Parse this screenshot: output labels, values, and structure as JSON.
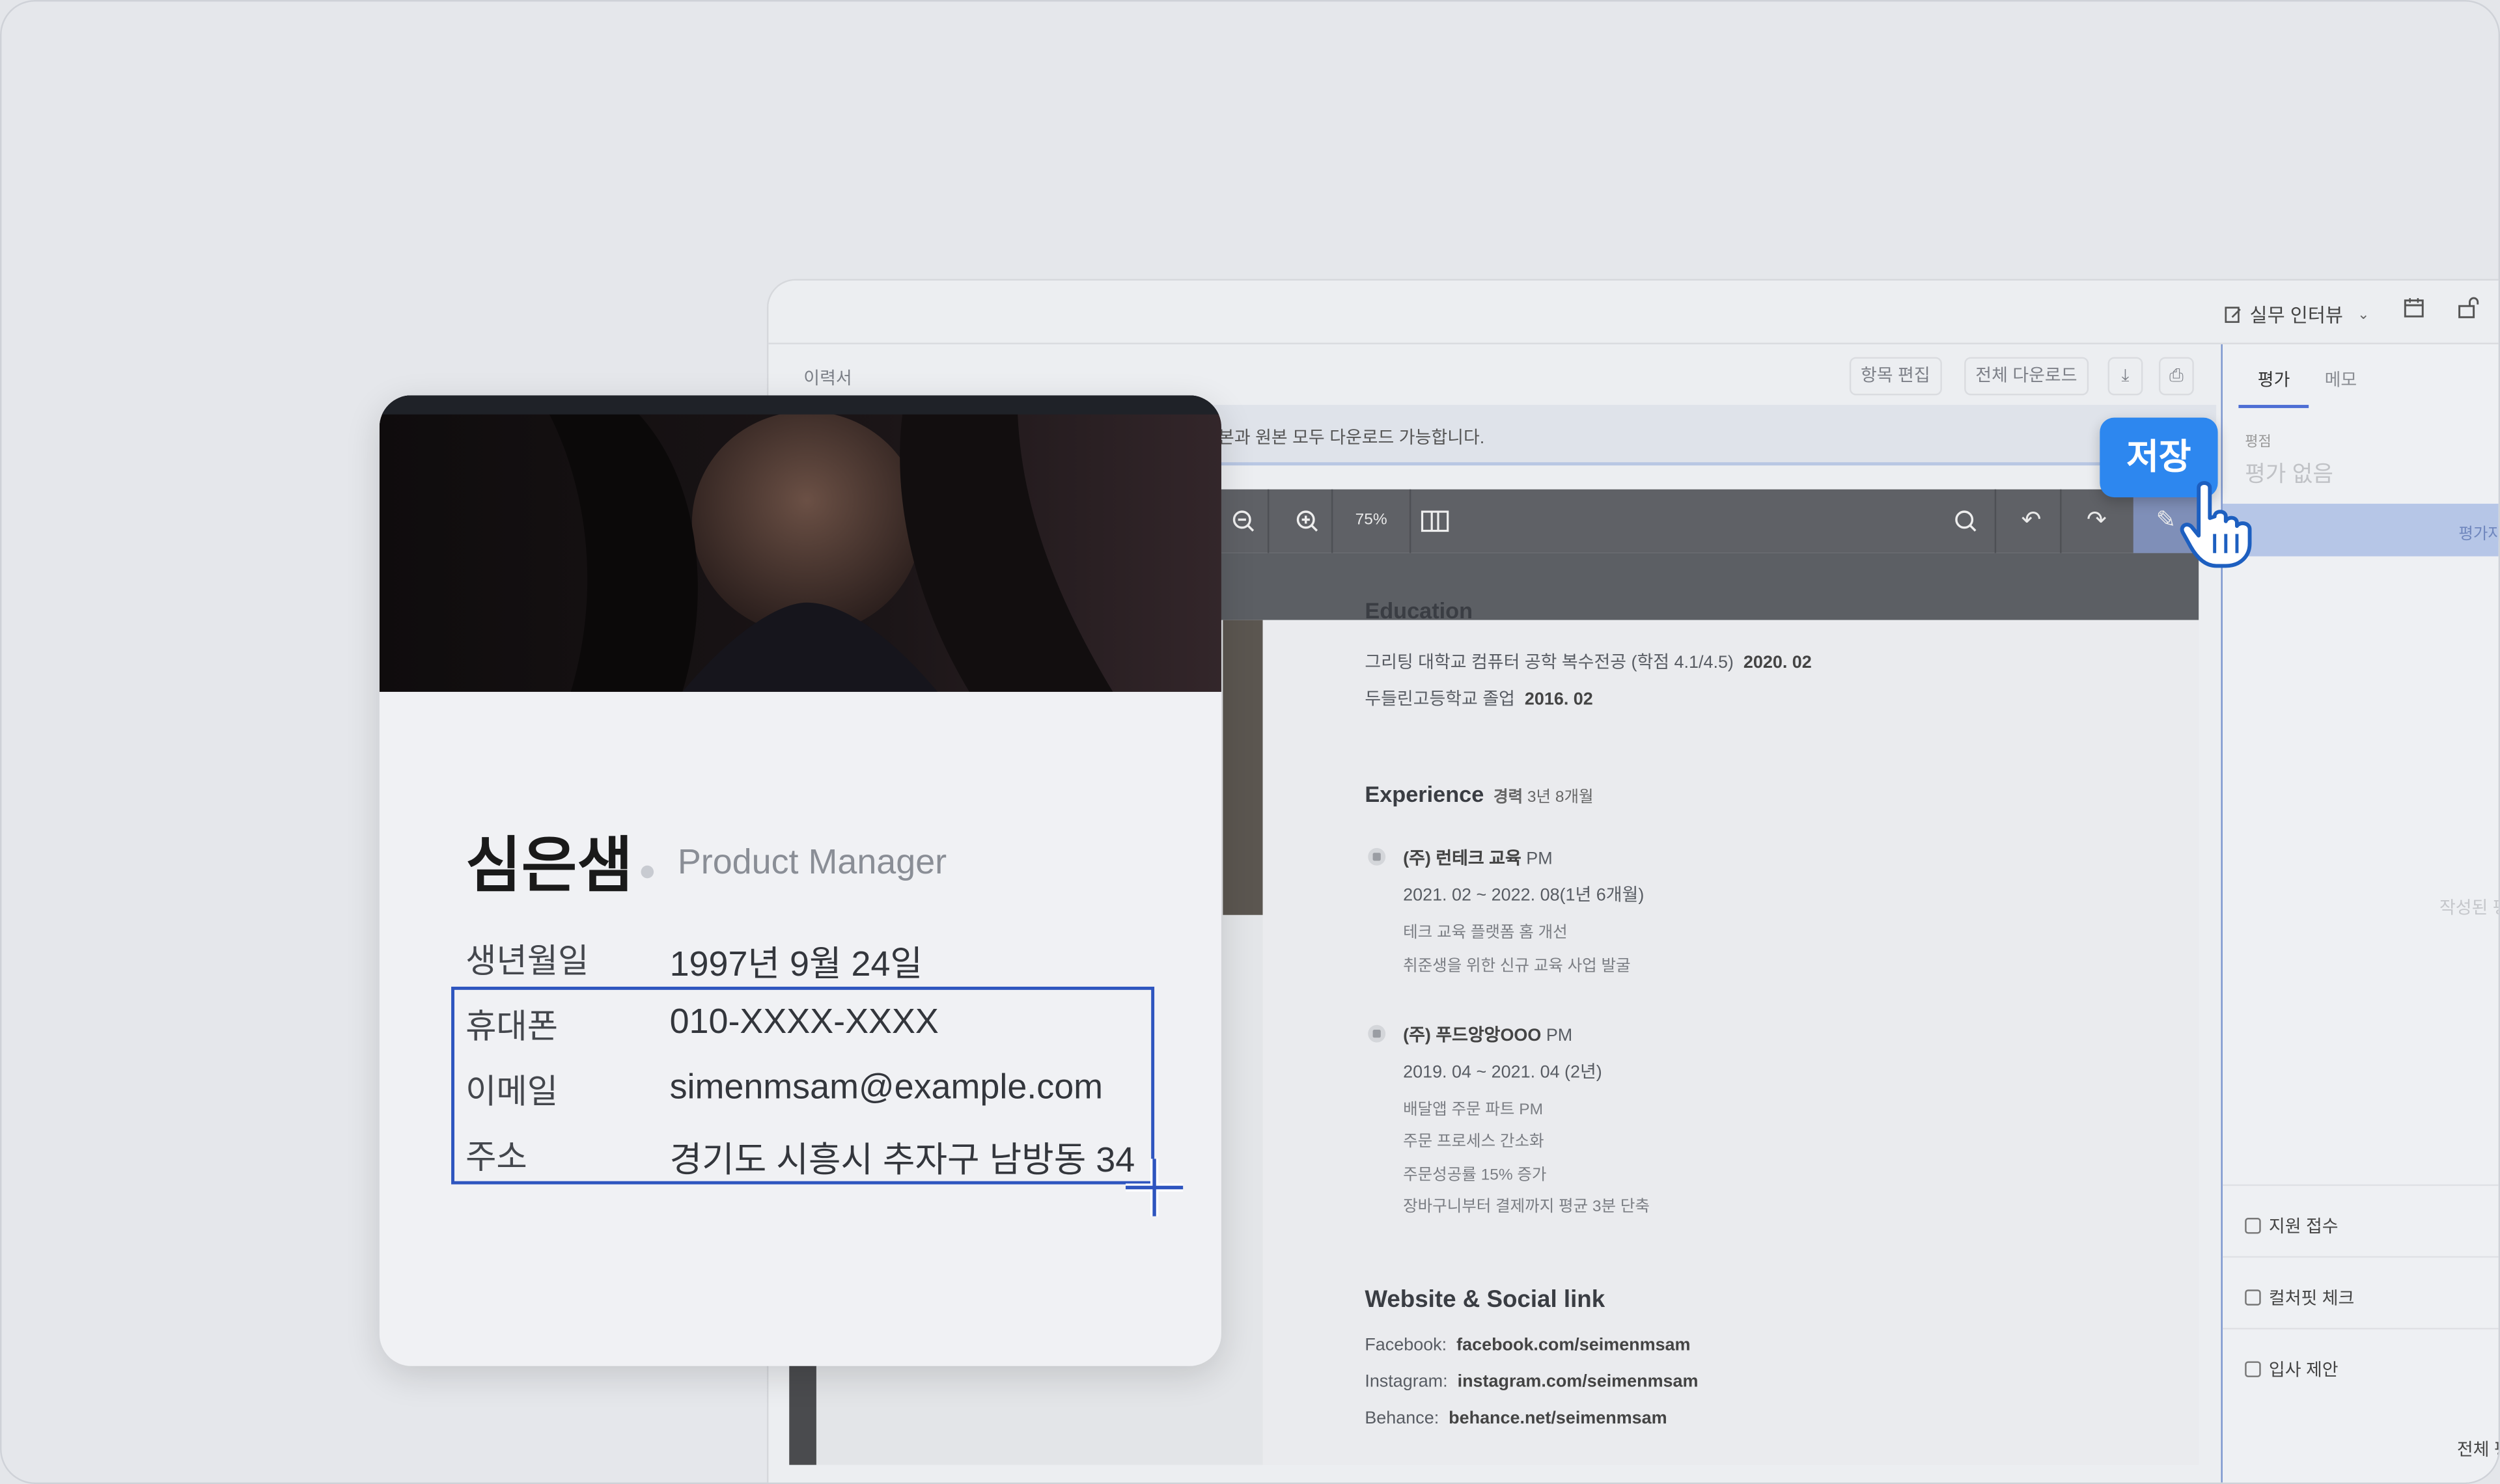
{
  "app": {
    "stage_dropdown": "실무 인터뷰",
    "section_title": "이력서",
    "toolbar": {
      "edit": "항목 편집",
      "download_all": "전체 다운로드"
    },
    "notice": "본과 원본 모두 다운로드 가능합니다.",
    "zoom": "75%"
  },
  "document": {
    "education_heading": "Education",
    "education": [
      {
        "text": "그리팅 대학교 컴퓨터 공학 복수전공 (학점 4.1/4.5)",
        "date": "2020. 02"
      },
      {
        "text": "두들린고등학교 졸업",
        "date": "2016. 02"
      }
    ],
    "experience_heading": "Experience",
    "experience_label": "경력",
    "experience_total": "3년 8개월",
    "experience": [
      {
        "company": "(주) 런테크 교육",
        "role": "PM",
        "period": "2021. 02 ~ 2022. 08(1년 6개월)",
        "lines": [
          "테크 교육 플랫폼 홈 개선",
          "취준생을 위한 신규 교육 사업 발굴"
        ]
      },
      {
        "company": "(주) 푸드앙앙OOO",
        "role": "PM",
        "period": "2019. 04 ~ 2021. 04 (2년)",
        "lines": [
          "배달앱 주문 파트 PM",
          "주문 프로세스 간소화",
          "주문성공률 15% 증가",
          "장바구니부터 결제까지 평균 3분 단축"
        ]
      }
    ],
    "links_heading": "Website & Social link",
    "links": [
      {
        "label": "Facebook:",
        "value": "facebook.com/seimenmsam"
      },
      {
        "label": "Instagram:",
        "value": "instagram.com/seimenmsam"
      },
      {
        "label": "Behance:",
        "value": "behance.net/seimenmsam"
      }
    ]
  },
  "panel": {
    "tabs": [
      "평가",
      "메모"
    ],
    "rating_label": "평점",
    "rating_value": "평가 없음",
    "band_text": "평가자",
    "empty_text": "작성된 평",
    "actions": [
      "지원 접수",
      "컬처핏 체크",
      "입사 제안"
    ],
    "all_label": "전체 평"
  },
  "save_button": "저장",
  "card": {
    "name": "심은샘",
    "role": "Product Manager",
    "rows": [
      {
        "key": "생년월일",
        "value": "1997년 9월 24일"
      },
      {
        "key": "휴대폰",
        "value": "010-XXXX-XXXX"
      },
      {
        "key": "이메일",
        "value": "simenmsam@example.com"
      },
      {
        "key": "주소",
        "value": "경기도 시흥시 추자구 남방동 34"
      }
    ]
  },
  "colors": {
    "accent": "#2d87ef",
    "selection": "#2e55bf",
    "panel_border": "#7b95cf"
  }
}
